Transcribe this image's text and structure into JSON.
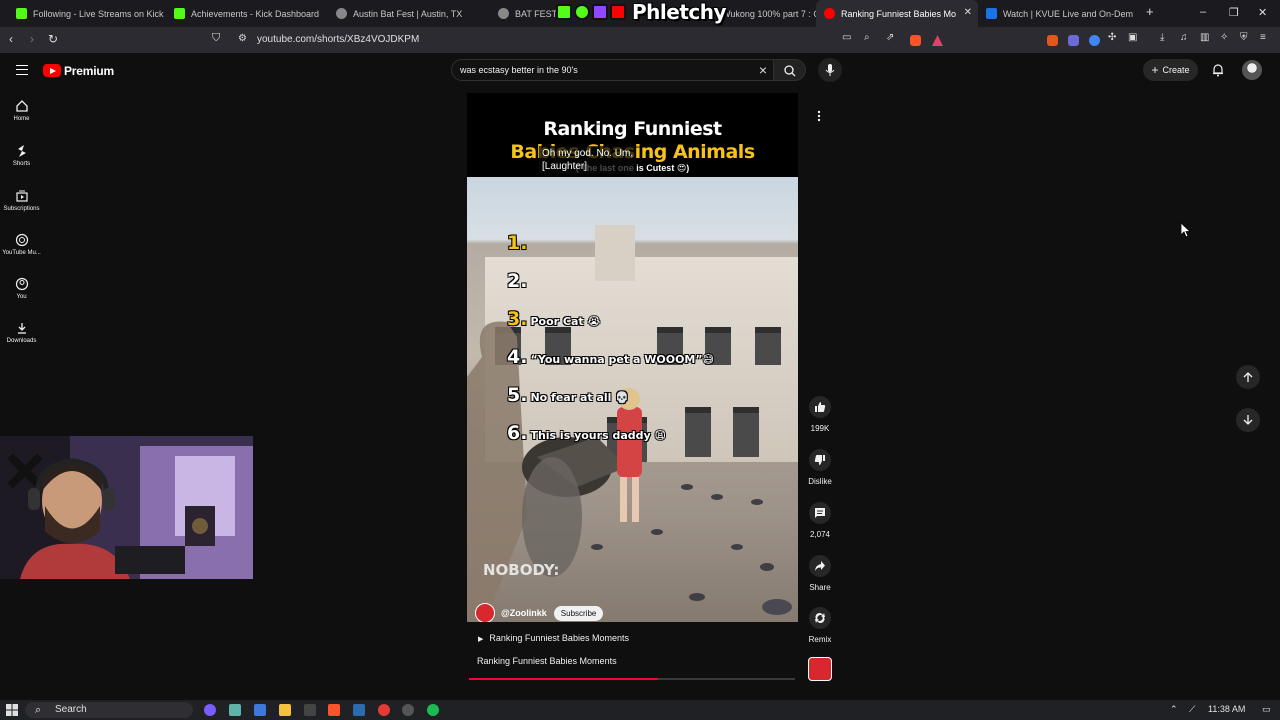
{
  "browser": {
    "tabs": [
      {
        "title": "Following - Live Streams on Kick",
        "color": "#53fc18"
      },
      {
        "title": "Achievements - Kick Dashboard",
        "color": "#53fc18"
      },
      {
        "title": "Austin Bat Fest | Austin, TX",
        "color": "#888888"
      },
      {
        "title": "BAT FEST 20",
        "color": "#888888"
      },
      {
        "title": "Wukong 100% part 7 : Cl",
        "color": "#888888"
      },
      {
        "title": "Ranking Funniest Babies Mo",
        "color": "#ff0000"
      },
      {
        "title": "Watch | KVUE Live and On-Dem",
        "color": "#1a73e8"
      }
    ],
    "url": "youtube.com/shorts/XBz4VOJDKPM"
  },
  "overlay": {
    "brand": "Phletchy"
  },
  "youtube": {
    "brand": "Premium",
    "search": {
      "value": "was ecstasy better in the 90's"
    },
    "create_label": "Create",
    "sidebar": [
      {
        "label": "Home",
        "icon": "home-icon"
      },
      {
        "label": "Shorts",
        "icon": "shorts-icon"
      },
      {
        "label": "Subscriptions",
        "icon": "subscriptions-icon"
      },
      {
        "label": "YouTube Mu...",
        "icon": "music-icon"
      },
      {
        "label": "You",
        "icon": "you-icon"
      },
      {
        "label": "Downloads",
        "icon": "download-icon"
      }
    ]
  },
  "video": {
    "title_line1": "Ranking Funniest",
    "title_line2": "Babies Chasing Animals",
    "subtitle": "( The last one is Cutest 😍)",
    "caption_line1": "Oh my god. No. Um,",
    "caption_line2": "[Laughter]",
    "ranks": [
      {
        "num": "1.",
        "label": ""
      },
      {
        "num": "2.",
        "label": ""
      },
      {
        "num": "3.",
        "label": "Poor Cat 😭"
      },
      {
        "num": "4.",
        "label": "“You wanna pet a WOOOM”😅"
      },
      {
        "num": "5.",
        "label": "No fear at all 💀"
      },
      {
        "num": "6.",
        "label": "This is yours daddy 😫"
      }
    ],
    "watermark_text": "NOBODY:",
    "channel": "@Zoolinkk",
    "subscribe_label": "Subscribe",
    "playlist_label": "Ranking Funniest Babies Moments",
    "bottom_title": "Ranking Funniest Babies Moments",
    "progress": 0.58
  },
  "actions": {
    "like_count": "199K",
    "dislike_label": "Dislike",
    "comment_count": "2,074",
    "share_label": "Share",
    "remix_label": "Remix"
  },
  "taskbar": {
    "search_label": "Search",
    "clock": "11:38 AM"
  }
}
